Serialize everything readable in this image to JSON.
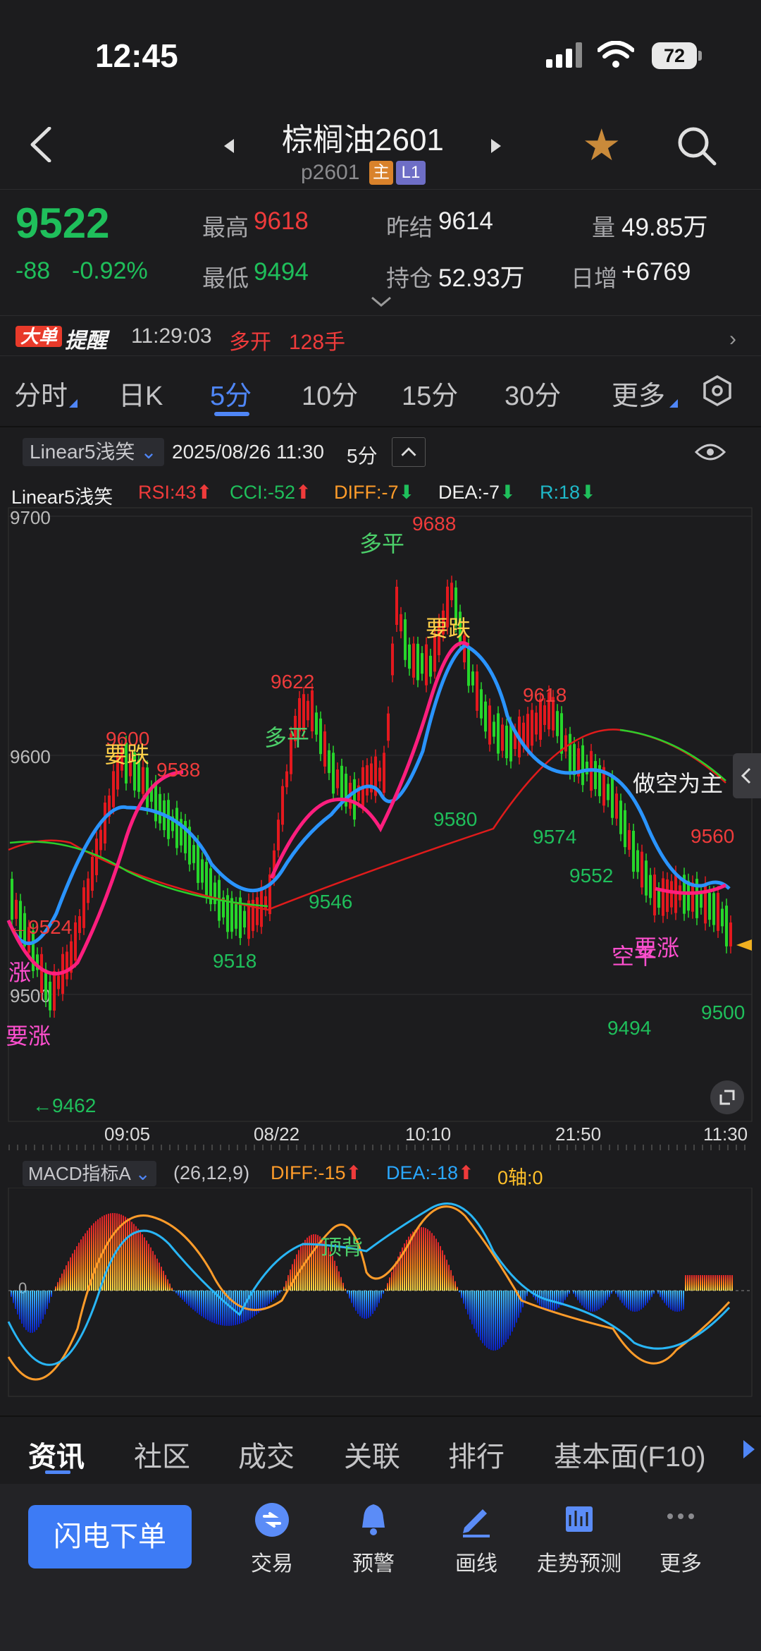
{
  "status_bar": {
    "time": "12:45",
    "battery": "72"
  },
  "nav": {
    "title": "棕榈油2601",
    "subtitle": "p2601",
    "tag_main": "主",
    "tag_level": "L1"
  },
  "quote": {
    "price": "9522",
    "change": "-88",
    "change_pct": "-0.92%",
    "high_label": "最高",
    "high": "9618",
    "low_label": "最低",
    "low": "9494",
    "prev_settle_label": "昨结",
    "prev_settle": "9614",
    "open_interest_label": "持仓",
    "open_interest": "52.93万",
    "volume_label": "量",
    "volume": "49.85万",
    "daily_inc_label": "日增",
    "daily_inc": "+6769"
  },
  "alert": {
    "badge1": "大单",
    "badge2": "提醒",
    "time": "11:29:03",
    "action": "多开",
    "lots": "128手"
  },
  "period_tabs": [
    "分时",
    "日K",
    "5分",
    "10分",
    "15分",
    "30分",
    "更多"
  ],
  "chart_toolbar": {
    "indicator": "Linear5浅笑",
    "datetime": "2025/08/26 11:30",
    "period": "5分"
  },
  "legend": {
    "name": "Linear5浅笑",
    "rsi": "RSI:43",
    "cci": "CCI:-52",
    "diff": "DIFF:-7",
    "dea": "DEA:-7",
    "r": "R:18"
  },
  "macd": {
    "indicator": "MACD指标A",
    "params": "(26,12,9)",
    "diff": "DIFF:-15",
    "dea": "DEA:-18",
    "axis": "0轴:0",
    "label_divergence": "顶背",
    "zero_label": "0"
  },
  "bottom_tabs": [
    "资讯",
    "社区",
    "成交",
    "关联",
    "排行",
    "基本面(F10)"
  ],
  "bottom_nav": {
    "flash_order": "闪电下单",
    "items": [
      "交易",
      "预警",
      "画线",
      "走势预测",
      "更多"
    ]
  },
  "colors": {
    "up": "#ef3b3b",
    "down": "#1fbf5b",
    "accent": "#4f86f7",
    "bg": "#1c1c1e"
  },
  "chart_data": {
    "type": "candlestick",
    "y_ticks": [
      "9700",
      "9600",
      "9500"
    ],
    "x_ticks": [
      "09:05",
      "08/22",
      "10:10",
      "21:50",
      "11:30"
    ],
    "price_labels": [
      {
        "text": "9688",
        "color": "red"
      },
      {
        "text": "9622",
        "color": "red"
      },
      {
        "text": "9618",
        "color": "red"
      },
      {
        "text": "9600",
        "color": "red"
      },
      {
        "text": "9588",
        "color": "red"
      },
      {
        "text": "9560",
        "color": "red"
      },
      {
        "text": "←9524",
        "color": "red"
      },
      {
        "text": "9580",
        "color": "green"
      },
      {
        "text": "9574",
        "color": "green"
      },
      {
        "text": "9552",
        "color": "green"
      },
      {
        "text": "9546",
        "color": "green"
      },
      {
        "text": "9518",
        "color": "green"
      },
      {
        "text": "9494",
        "color": "green"
      },
      {
        "text": "9500",
        "color": "green"
      },
      {
        "text": "←9462",
        "color": "green"
      }
    ],
    "signals": [
      {
        "text": "多平",
        "color": "green"
      },
      {
        "text": "要跌",
        "color": "yellow"
      },
      {
        "text": "多平",
        "color": "green"
      },
      {
        "text": "要跌",
        "color": "yellow"
      },
      {
        "text": "做空为主",
        "color": "white"
      },
      {
        "text": "空平",
        "color": "magenta"
      },
      {
        "text": "要涨",
        "color": "magenta"
      },
      {
        "text": "要涨",
        "color": "magenta"
      },
      {
        "text": "涨",
        "color": "magenta"
      }
    ]
  }
}
